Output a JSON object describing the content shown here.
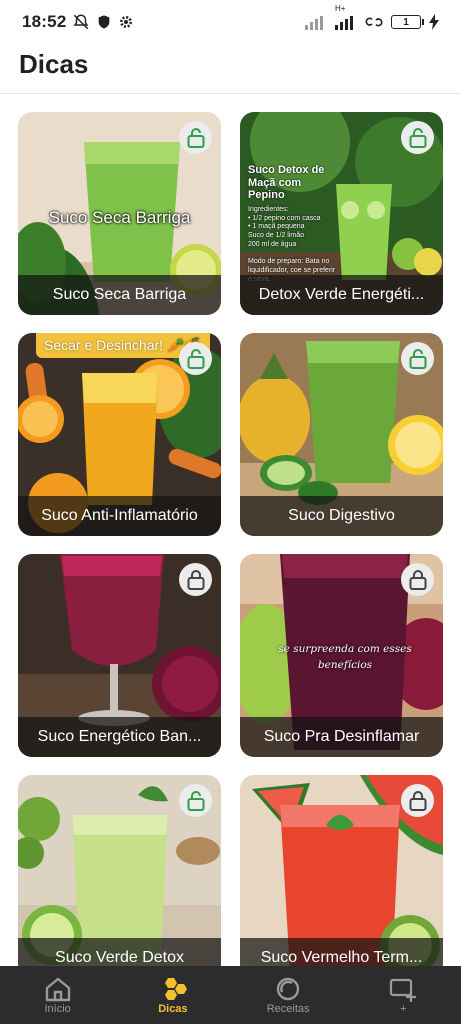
{
  "status_bar": {
    "time": "18:52",
    "network": "H+",
    "battery": "1"
  },
  "header": {
    "title": "Dicas"
  },
  "cards": [
    {
      "label": "Suco Seca Barriga",
      "overlay": "Suco Seca Barriga",
      "locked": false
    },
    {
      "label": "Detox Verde Energéti...",
      "locked": false,
      "recipe_title": "Suco Detox de Maçã com Pepino",
      "recipe_text": "Ingredientes:\n• 1/2 pepino com casca\n• 1 maçã pequena\n  Suco de 1/2 limão\n  200 ml de água\n\nModo de preparo: Bata no liquidificador, coe se preferir e sirva."
    },
    {
      "label": "Suco Anti-Inflamatório",
      "ribbon": "Secar e Desinchar! 🥕🍊",
      "locked": false
    },
    {
      "label": "Suco Digestivo",
      "locked": false
    },
    {
      "label": "Suco Energético Ban...",
      "locked": true
    },
    {
      "label": "Suco Pra Desinflamar",
      "overlay_italic": "se surpreenda com esses benefícios",
      "locked": true
    },
    {
      "label": "Suco Verde Detox",
      "locked": false
    },
    {
      "label": "Suco Vermelho Term...",
      "locked": true
    }
  ],
  "bottom_nav": [
    {
      "label": "Início",
      "icon": "home-icon"
    },
    {
      "label": "Dicas",
      "icon": "honeycomb-icon",
      "active": true
    },
    {
      "label": "Receitas",
      "icon": "ring-icon"
    },
    {
      "label": "+",
      "icon": "add-screen-icon"
    }
  ],
  "colors": {
    "accent": "#f2c230",
    "unlocked": "#2e9e4a",
    "locked": "#444444",
    "nav_bg": "#2c2c2c"
  }
}
